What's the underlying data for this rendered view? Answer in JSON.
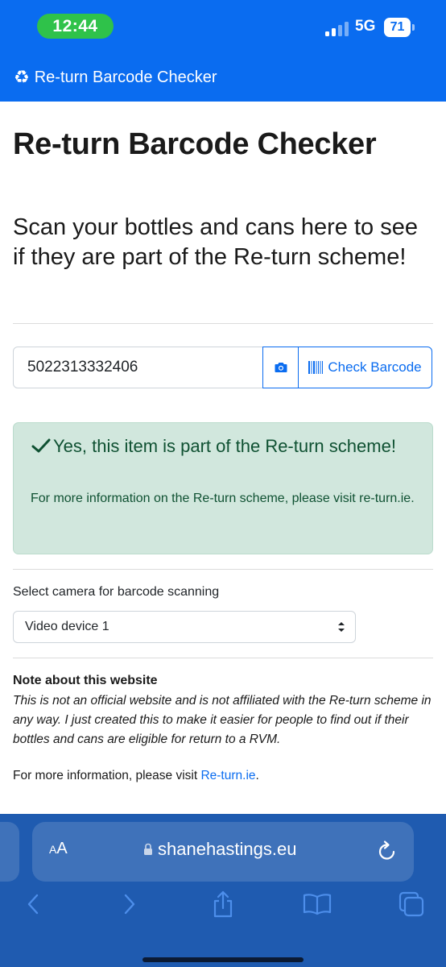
{
  "status_bar": {
    "time": "12:44",
    "network": "5G",
    "battery": "71"
  },
  "header": {
    "brand_title": "Re-turn Barcode Checker",
    "brand_icon": "recycle-icon"
  },
  "main": {
    "title": "Re-turn Barcode Checker",
    "lead": "Scan your bottles and cans here to see if they are part of the Re-turn scheme!",
    "barcode_input_value": "5022313332406",
    "camera_button_icon": "camera-icon",
    "check_button_label": "Check Barcode",
    "result": {
      "heading": "Yes, this item is part of the Re-turn scheme!",
      "body": "For more information on the Re-turn scheme, please visit re-turn.ie."
    },
    "camera_select_label": "Select camera for barcode scanning",
    "camera_select_value": "Video device 1",
    "note": {
      "title": "Note about this website",
      "body": "This is not an official website and is not affiliated with the Re-turn scheme in any way. I just created this to make it easier for people to find out if their bottles and cans are eligible for return to a RVM.",
      "more_info_prefix": "For more information, please visit ",
      "more_info_link": "Re-turn.ie",
      "more_info_suffix": "."
    }
  },
  "browser": {
    "text_size_label_a": "A",
    "text_size_label_b": "A",
    "url": "shanehastings.eu"
  },
  "colors": {
    "brand_blue": "#0a6cf0",
    "success_bg": "#d1e7dd",
    "success_text": "#0f5132",
    "time_pill": "#2fc24a",
    "safari_bar": "#1f5bb0"
  }
}
